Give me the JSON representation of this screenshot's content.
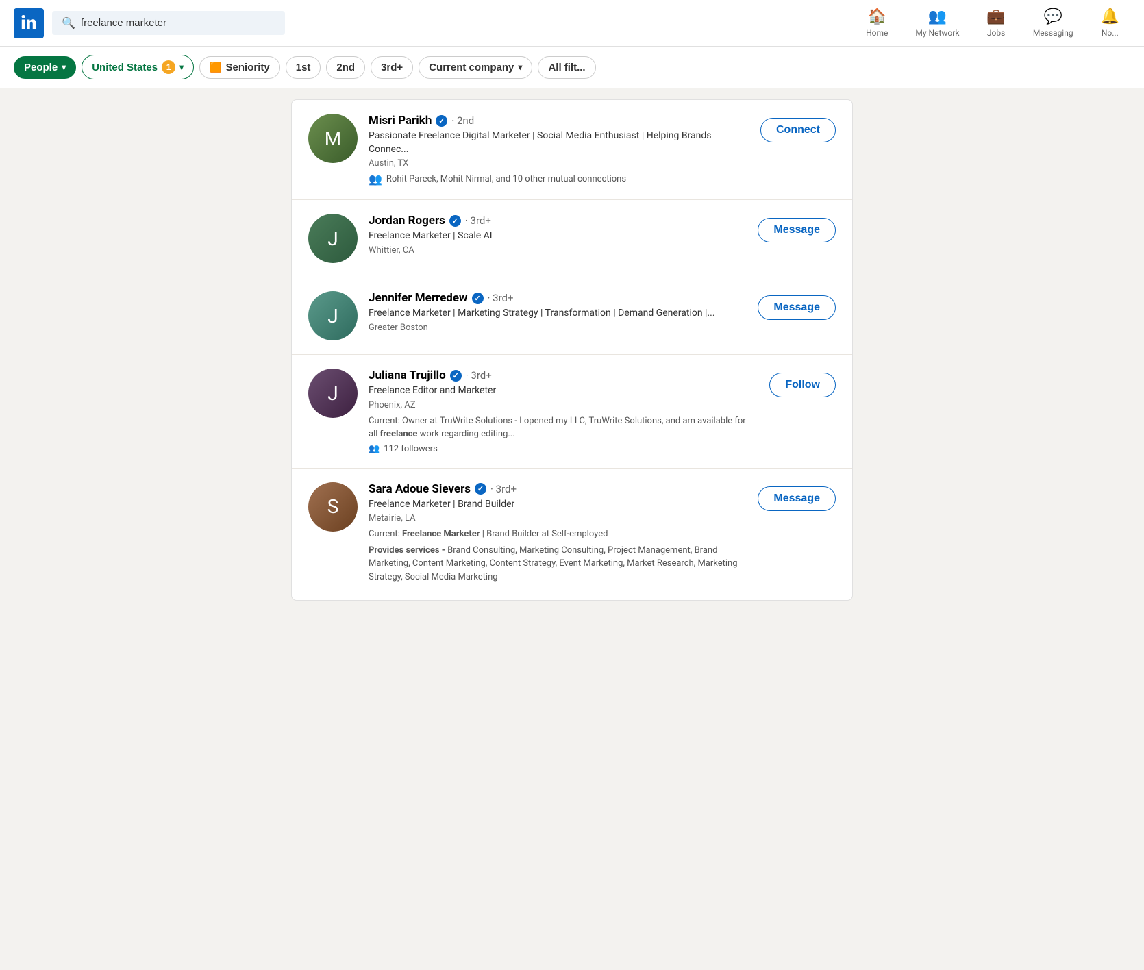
{
  "header": {
    "logo_text": "in",
    "search_value": "freelance marketer",
    "search_placeholder": "Search",
    "nav": [
      {
        "label": "Home",
        "icon": "🏠",
        "name": "home"
      },
      {
        "label": "My Network",
        "icon": "👥",
        "name": "my-network"
      },
      {
        "label": "Jobs",
        "icon": "💼",
        "name": "jobs"
      },
      {
        "label": "Messaging",
        "icon": "💬",
        "name": "messaging"
      },
      {
        "label": "No...",
        "icon": "🔔",
        "name": "notifications"
      }
    ]
  },
  "filters": [
    {
      "label": "People",
      "type": "active-green",
      "has_chevron": true,
      "name": "filter-people"
    },
    {
      "label": "United States",
      "badge": "1",
      "type": "active-outline",
      "has_chevron": true,
      "name": "filter-location"
    },
    {
      "label": "🟧 Seniority",
      "type": "default",
      "has_chevron": false,
      "name": "filter-seniority"
    },
    {
      "label": "1st",
      "type": "default",
      "has_chevron": false,
      "name": "filter-1st"
    },
    {
      "label": "2nd",
      "type": "default",
      "has_chevron": false,
      "name": "filter-2nd"
    },
    {
      "label": "3rd+",
      "type": "default",
      "has_chevron": false,
      "name": "filter-3rd"
    },
    {
      "label": "Current company",
      "type": "default",
      "has_chevron": true,
      "name": "filter-company"
    },
    {
      "label": "All filt...",
      "type": "default",
      "has_chevron": false,
      "name": "filter-all"
    }
  ],
  "results": [
    {
      "name": "Misri Parikh",
      "degree": "· 2nd",
      "title": "Passionate Freelance Digital Marketer | Social Media Enthusiast | Helping Brands Connec...",
      "location": "Austin, TX",
      "mutual": "Rohit Pareek, Mohit Nirmal, and 10 other mutual connections",
      "current": "",
      "followers": "",
      "services": "",
      "action_label": "Connect",
      "avatar_class": "avatar-1",
      "avatar_letter": "M"
    },
    {
      "name": "Jordan Rogers",
      "degree": "· 3rd+",
      "title": "Freelance Marketer | Scale AI",
      "location": "Whittier, CA",
      "mutual": "",
      "current": "",
      "followers": "",
      "services": "",
      "action_label": "Message",
      "avatar_class": "avatar-2",
      "avatar_letter": "J"
    },
    {
      "name": "Jennifer Merredew",
      "degree": "· 3rd+",
      "title": "Freelance Marketer | Marketing Strategy | Transformation | Demand Generation |...",
      "location": "Greater Boston",
      "mutual": "",
      "current": "",
      "followers": "",
      "services": "",
      "action_label": "Message",
      "avatar_class": "avatar-3",
      "avatar_letter": "J"
    },
    {
      "name": "Juliana Trujillo",
      "degree": "· 3rd+",
      "title": "Freelance Editor and Marketer",
      "location": "Phoenix, AZ",
      "mutual": "",
      "current": "Current: Owner at TruWrite Solutions - I opened my LLC, TruWrite Solutions, and am available for all freelance work regarding editing...",
      "current_bold_word": "freelance",
      "followers": "112 followers",
      "services": "",
      "action_label": "Follow",
      "avatar_class": "avatar-4",
      "avatar_letter": "J"
    },
    {
      "name": "Sara Adoue Sievers",
      "degree": "· 3rd+",
      "title": "Freelance Marketer | Brand Builder",
      "location": "Metairie, LA",
      "mutual": "",
      "current": "Current: Freelance Marketer | Brand Builder at Self-employed",
      "current_bold": "Freelance Marketer",
      "followers": "",
      "services": "Provides services - Brand Consulting, Marketing Consulting, Project Management, Brand Marketing, Content Marketing, Content Strategy, Event Marketing, Market Research, Marketing Strategy, Social Media Marketing",
      "action_label": "Message",
      "avatar_class": "avatar-5",
      "avatar_letter": "S"
    }
  ]
}
